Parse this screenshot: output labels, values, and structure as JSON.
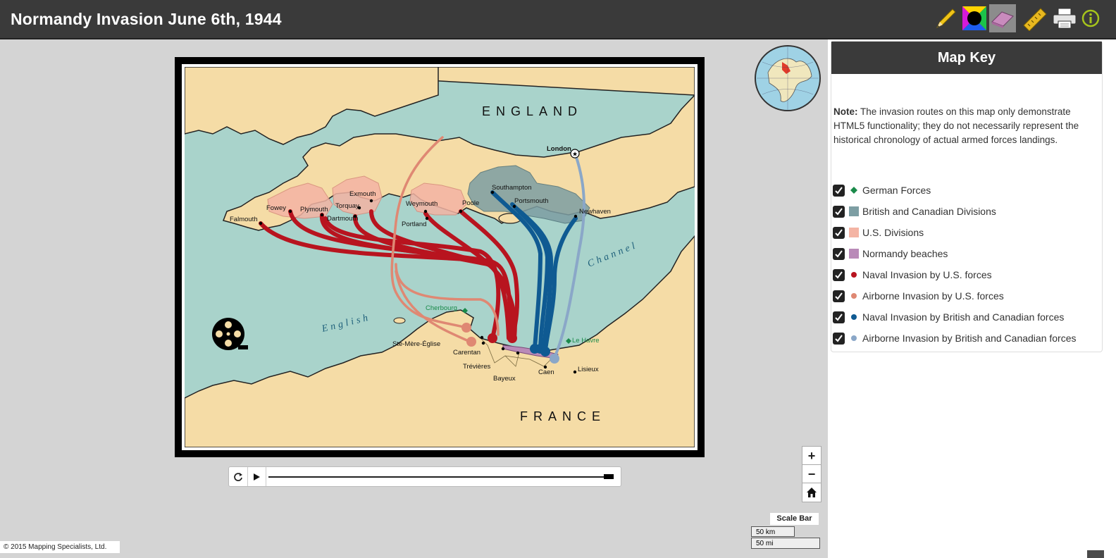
{
  "app": {
    "title": "Normandy Invasion June 6th, 1944",
    "copyright": "© 2015 Mapping Specialists, Ltd."
  },
  "toolbar": {
    "tools": [
      {
        "name": "pencil-icon",
        "color": "#f0c419"
      },
      {
        "name": "color-wheel-icon",
        "color": "#000000"
      },
      {
        "name": "eraser-icon",
        "color": "#c98bbd",
        "active": true
      },
      {
        "name": "ruler-icon",
        "color": "#e8b820"
      },
      {
        "name": "print-icon",
        "color": "#ffffff"
      },
      {
        "name": "info-icon",
        "color": "#a6c41c"
      }
    ]
  },
  "map": {
    "labels": {
      "england": "ENGLAND",
      "france": "FRANCE",
      "english": "English",
      "channel": "Channel"
    },
    "places": [
      {
        "key": "falmouth",
        "label": "Falmouth"
      },
      {
        "key": "fowey",
        "label": "Fowey"
      },
      {
        "key": "plymouth",
        "label": "Plymouth"
      },
      {
        "key": "dartmouth",
        "label": "Dartmouth"
      },
      {
        "key": "torquay",
        "label": "Torquay"
      },
      {
        "key": "exmouth",
        "label": "Exmouth"
      },
      {
        "key": "weymouth",
        "label": "Weymouth"
      },
      {
        "key": "portland",
        "label": "Portland"
      },
      {
        "key": "poole",
        "label": "Poole"
      },
      {
        "key": "southampton",
        "label": "Southampton"
      },
      {
        "key": "portsmouth",
        "label": "Portsmouth"
      },
      {
        "key": "newhaven",
        "label": "Newhaven"
      },
      {
        "key": "london",
        "label": "London"
      },
      {
        "key": "cherbourg",
        "label": "Cherbourg"
      },
      {
        "key": "le_havre",
        "label": "Le Havre"
      },
      {
        "key": "ste_mere",
        "label": "Ste-Mère-Église"
      },
      {
        "key": "carentan",
        "label": "Carentan"
      },
      {
        "key": "trevieres",
        "label": "Trévières"
      },
      {
        "key": "bayeux",
        "label": "Bayeux"
      },
      {
        "key": "caen",
        "label": "Caen"
      },
      {
        "key": "lisieux",
        "label": "Lisieux"
      }
    ],
    "colors": {
      "sea": "#a9d3cb",
      "land": "#f5dca6",
      "us_divisions": "#f4b4a4",
      "british_divisions": "#7d9ea3",
      "naval_us": "#b8141f",
      "airborne_us": "#df8873",
      "naval_british": "#0f5a92",
      "airborne_british": "#8aa7c8",
      "beaches": "#b98ab8",
      "german": "#1a8a4a"
    }
  },
  "player": {
    "replay_icon": "replay-icon",
    "play_icon": "play-icon",
    "progress": 1.0
  },
  "zoom": {
    "in": "+",
    "out": "−",
    "home_icon": "home-icon"
  },
  "scalebar": {
    "label": "Scale Bar",
    "km": "50 km",
    "mi": "50 mi"
  },
  "key": {
    "title": "Map Key",
    "note_label": "Note:",
    "note_text": " The invasion routes on this map only demonstrate HTML5 functionality; they do not necessarily represent the historical chronology of actual armed forces landings.",
    "items": [
      {
        "label": "German Forces",
        "symbol": "diamond",
        "color": "#1a8a4a",
        "checked": true
      },
      {
        "label": "British and Canadian Divisions",
        "symbol": "square",
        "color": "#7d9ea3",
        "checked": true
      },
      {
        "label": "U.S. Divisions",
        "symbol": "square",
        "color": "#f4b4a4",
        "checked": true
      },
      {
        "label": "Normandy beaches",
        "symbol": "square",
        "color": "#b98ab8",
        "checked": true
      },
      {
        "label": "Naval Invasion by U.S. forces",
        "symbol": "circle",
        "color": "#b8141f",
        "checked": true
      },
      {
        "label": "Airborne Invasion by U.S. forces",
        "symbol": "circle",
        "color": "#df8873",
        "checked": true
      },
      {
        "label": "Naval Invasion by British and Canadian forces",
        "symbol": "circle",
        "color": "#0f5a92",
        "checked": true
      },
      {
        "label": "Airborne Invasion by British and Canadian forces",
        "symbol": "circle",
        "color": "#8aa7c8",
        "checked": true
      }
    ]
  }
}
